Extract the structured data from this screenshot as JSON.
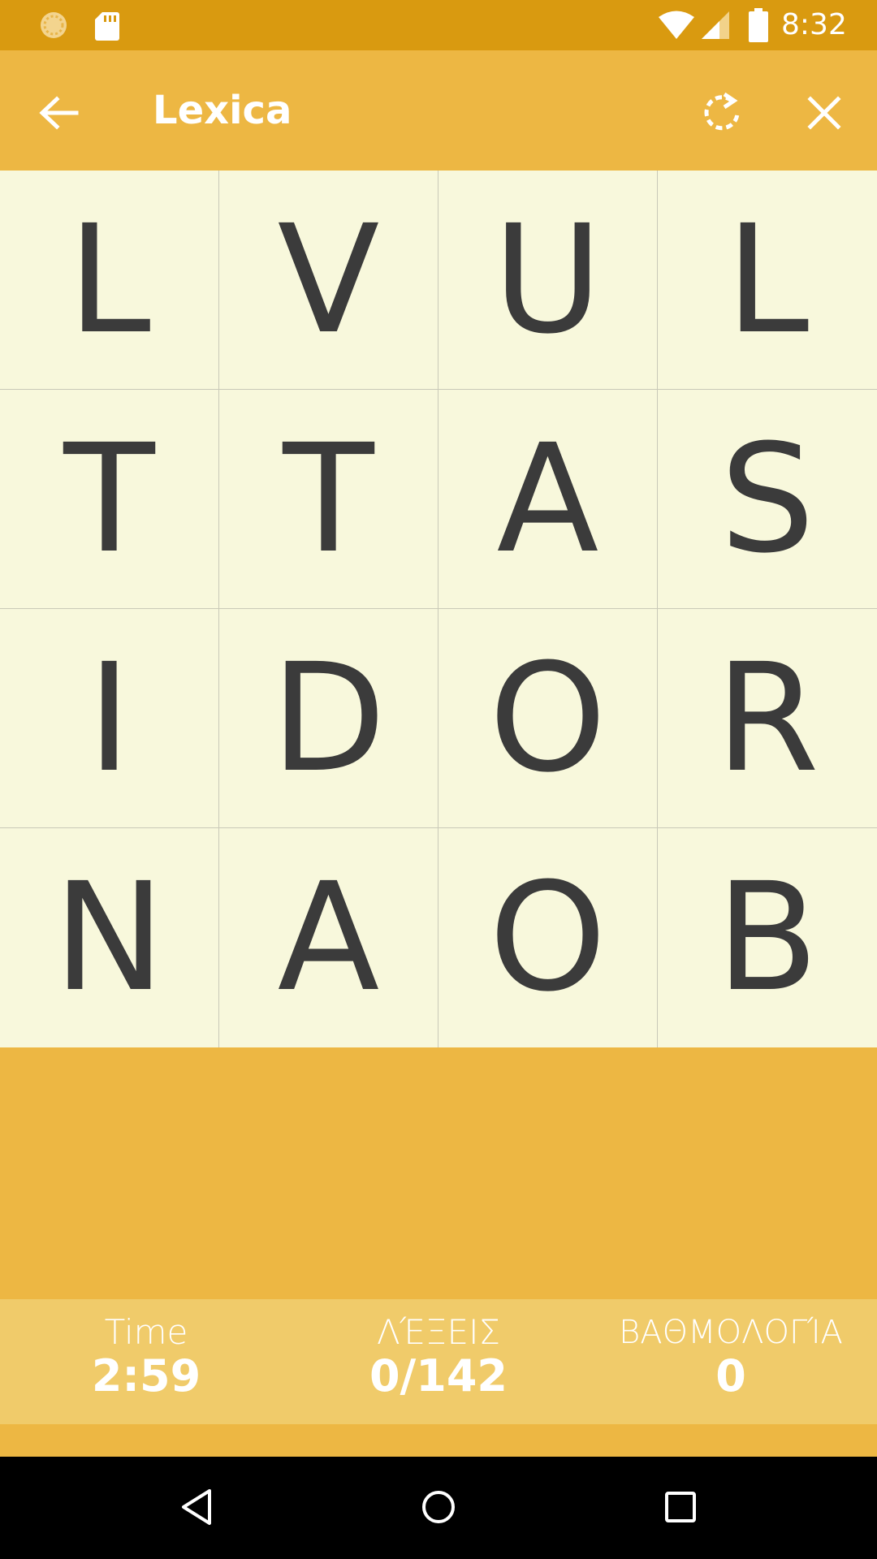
{
  "status_bar": {
    "time": "8:32",
    "icons": [
      "sync-icon",
      "sd-card-icon",
      "wifi-icon",
      "signal-icon",
      "battery-icon"
    ]
  },
  "app_bar": {
    "title": "Lexica",
    "icons": [
      "back-arrow-icon",
      "refresh-icon",
      "close-icon"
    ]
  },
  "board": {
    "rows": [
      [
        "L",
        "V",
        "U",
        "L"
      ],
      [
        "T",
        "T",
        "A",
        "S"
      ],
      [
        "I",
        "D",
        "O",
        "R"
      ],
      [
        "N",
        "A",
        "O",
        "B"
      ]
    ]
  },
  "stats": {
    "time_label": "Time",
    "time_value": "2:59",
    "words_label": "ΛΈΞΕΙΣ",
    "words_value": "0/142",
    "score_label": "ΒΑΘΜΟΛΟΓΊΑ",
    "score_value": "0"
  },
  "nav_bar": {
    "icons": [
      "nav-back-icon",
      "nav-home-icon",
      "nav-recents-icon"
    ]
  },
  "colors": {
    "status_bar": "#D99A10",
    "primary": "#EDB743",
    "stats_bar": "#F0CB6A",
    "board_bg": "#F8F8DC",
    "letter": "#3B3B3B"
  }
}
